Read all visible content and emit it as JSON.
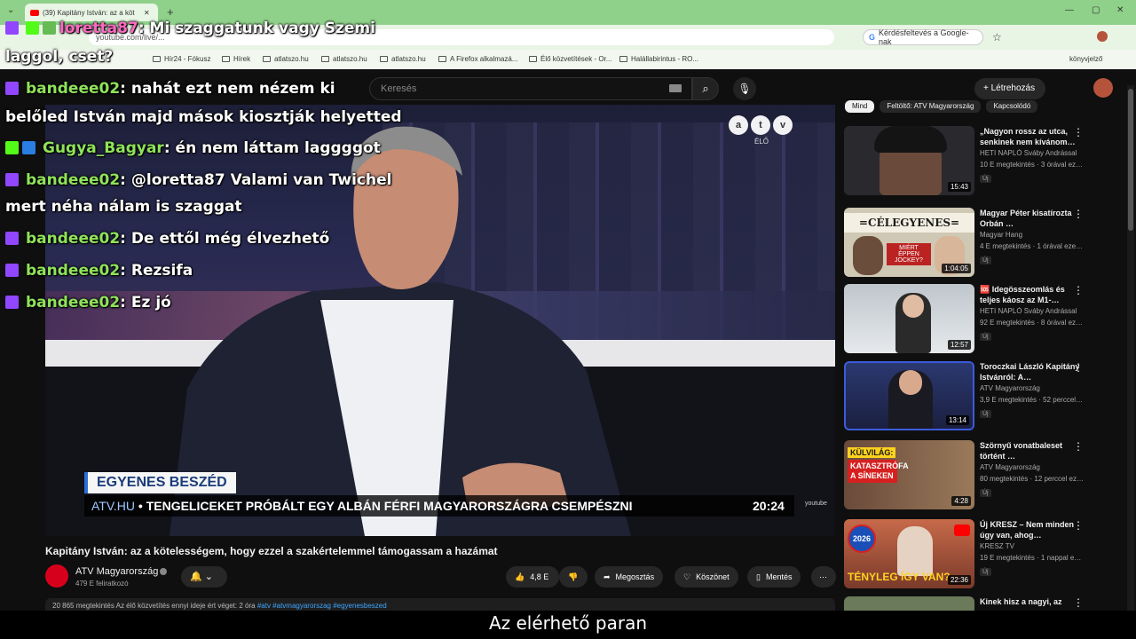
{
  "browser": {
    "tab_title": "(39) Kapitány István: az a köt",
    "url": "youtube.com/live/...",
    "ask_google": "Kérdésfeltevés a Google-nak",
    "bookmarks": [
      "Hír24 - Fókusz",
      "Hírek",
      "atlatszo.hu",
      "atlatszo.hu",
      "atlatszo.hu",
      "A Firefox alkalmazá...",
      "Élő közvetítések - Or...",
      "Halállabirintus - RO..."
    ],
    "other_bookmarks": "könyvjelző"
  },
  "chat": [
    {
      "platform": "twitch",
      "user": "loretta87",
      "text": ": Mi szaggatunk vagy Szemi",
      "user_color": "pink"
    },
    {
      "platform": "none",
      "user": "",
      "text": "laggol, cset?"
    },
    {
      "platform": "twitch",
      "user": "bandeee02",
      "text": ": nahát ezt nem nézem ki"
    },
    {
      "platform": "none",
      "user": "",
      "text": "belőled István majd mások kiosztják helyetted"
    },
    {
      "platform": "kick",
      "user": "Gugya_Bagyar",
      "text": ": én nem láttam laggggot"
    },
    {
      "platform": "twitch",
      "user": "bandeee02",
      "text": ": @loretta87 Valami van Twichel"
    },
    {
      "platform": "none",
      "user": "",
      "text": "mert néha nálam is szaggat"
    },
    {
      "platform": "twitch",
      "user": "bandeee02",
      "text": ": De ettől még élvezhető"
    },
    {
      "platform": "twitch",
      "user": "bandeee02",
      "text": ": Rezsifa"
    },
    {
      "platform": "twitch",
      "user": "bandeee02",
      "text": ": Ez jó"
    }
  ],
  "header": {
    "search_placeholder": "Keresés",
    "create_label": "Létrehozás"
  },
  "player": {
    "channel_logo": [
      "a",
      "t",
      "v"
    ],
    "live_label": "ÉLŐ",
    "lower_title": "EGYENES BESZÉD",
    "ticker_source": "ATV.HU",
    "ticker_text": "• TENGELICEKET PRÓBÁLT EGY ALBÁN FÉRFI MAGYARORSZÁGRA CSEMPÉSZNI",
    "clock": "20:24",
    "bug": "youtube"
  },
  "video": {
    "title": "Kapitány István: az a kötelességem, hogy ezzel a szakértelemmel támogassam a hazámat",
    "channel": "ATV Magyarország",
    "subscribers": "479 E feliratkozó",
    "likes": "4,8 E",
    "share": "Megosztás",
    "thanks": "Köszönet",
    "save": "Mentés",
    "description": "20 865 megtekintés  Az élő közvetítés ennyi ideje ért véget: 2 óra",
    "tags": "#atv #atvmagyarorszag #egyenesbeszed"
  },
  "chips": [
    "Mind",
    "Feltöltő: ATV Magyarország",
    "Kapcsolódó"
  ],
  "recommendations": [
    {
      "title": "„Nagyon rossz az utca, senkinek nem kívánom…",
      "channel": "HETI NAPLÓ Sváby Andrással",
      "meta": "10 E megtekintés · 3 órával ez…",
      "duration": "15:43",
      "new": "Új",
      "thumb": "#2a2a2e"
    },
    {
      "title": "Magyar Péter kisatírozta Orbán …",
      "channel": "Magyar Hang",
      "meta": "4 E megtekintés · 1 órával eze…",
      "duration": "1:04:05",
      "new": "Új",
      "thumb": "#c9c3b5"
    },
    {
      "title": "🆘 Idegösszeomlás és teljes káosz az M1-…",
      "channel": "HETI NAPLÓ Sváby Andrással",
      "meta": "92 E megtekintés · 8 órával ez…",
      "duration": "12:57",
      "new": "Új",
      "thumb": "#cfd2d6"
    },
    {
      "title": "Toroczkai László Kapitány Istvánról: A…",
      "channel": "ATV Magyarország",
      "meta": "3,9 E megtekintés · 52 perccel…",
      "duration": "13:14",
      "new": "Új",
      "thumb": "#2b3870"
    },
    {
      "title": "Szörnyű vonatbaleset történt …",
      "channel": "ATV Magyarország",
      "meta": "80 megtekintés · 12 perccel ez…",
      "duration": "4:28",
      "new": "Új",
      "thumb": "#8a5a3c"
    },
    {
      "title": "Új KRESZ – Nem minden úgy van, ahog…",
      "channel": "KRESZ TV",
      "meta": "19 E megtekintés · 1 nappal e…",
      "duration": "22:36",
      "new": "Új",
      "thumb": "#b85a3d"
    },
    {
      "title": "Kinek hisz a nagyi, az",
      "channel": "",
      "meta": "",
      "duration": "",
      "new": "",
      "thumb": "#6a7a5a"
    }
  ],
  "thumb_texts": {
    "celegyenes": "=CÉLEGYENES=",
    "celegyenes_sub": "MIÉRT ÉPPEN JOCKEY?",
    "kulvilag": "KÜLVILÁG:",
    "kulvilag_sub": "KATASZTRÓFA A SÍNEKEN",
    "kresz_year": "2026",
    "kresz_text": "TÉNYLEG ÍGY VAN?"
  },
  "caption": "Az elérhető paran"
}
